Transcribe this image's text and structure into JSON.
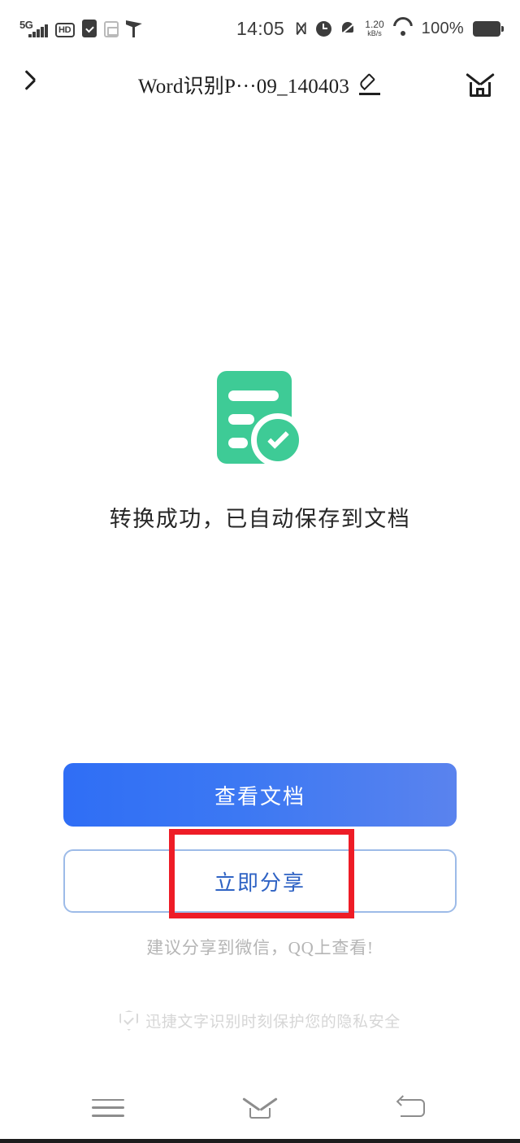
{
  "statusbar": {
    "network_type": "5G",
    "hd_label": "HD",
    "time": "14:05",
    "nfc_label": "N",
    "netspeed_value": "1.20",
    "netspeed_unit": "kB/s",
    "battery_percent": "100%",
    "icons": [
      "signal-bars-icon",
      "hd-icon",
      "clipboard-check-icon",
      "network-disabled-icon",
      "broadcast-tower-icon",
      "nfc-off-icon",
      "alarm-icon",
      "bell-off-icon",
      "wifi-icon",
      "battery-full-icon"
    ]
  },
  "header": {
    "back_icon": "chevron-left-icon",
    "title": "Word识别P···09_140403",
    "edit_icon": "pencil-icon",
    "home_icon": "home-icon"
  },
  "hero": {
    "icon": "document-check-icon",
    "icon_color": "#3ECB96",
    "success_text": "转换成功，已自动保存到文档"
  },
  "actions": {
    "primary_label": "查看文档",
    "primary_gradient_from": "#2F6EF5",
    "primary_gradient_to": "#5A83EE",
    "secondary_label": "立即分享",
    "secondary_text_color": "#2F63C4",
    "secondary_border_color": "#9DBBE8",
    "share_hint": "建议分享到微信，QQ上查看!",
    "privacy_icon": "shield-check-icon",
    "privacy_text": "迅捷文字识别时刻保护您的隐私安全"
  },
  "annotation": {
    "type": "highlight-rectangle",
    "color": "#EE1C26",
    "targets": "查看文档"
  },
  "navbar": {
    "recents_icon": "menu-icon",
    "home_icon": "home-outline-icon",
    "back_icon": "back-arrow-icon"
  }
}
